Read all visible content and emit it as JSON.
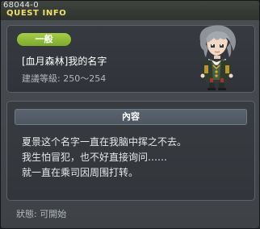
{
  "window": {
    "quest_id": "68044-0",
    "title": "QUEST INFO"
  },
  "quest": {
    "category_badge": "一般",
    "name": "[血月森林]我的名字",
    "level_requirement": "建議等級: 250～254",
    "character_icon": "character-portrait"
  },
  "content": {
    "header": "內容",
    "lines": [
      "夏景这个名字一直在我脑中挥之不去。",
      "我生怕冒犯，也不好直接询问……",
      "就一直在乘司因周围打转。"
    ]
  },
  "status": {
    "text": "狀態: 可開始"
  },
  "colors": {
    "title": "#f0e06a",
    "badge": "#8cb83a",
    "panel_border": "#5d6268"
  }
}
